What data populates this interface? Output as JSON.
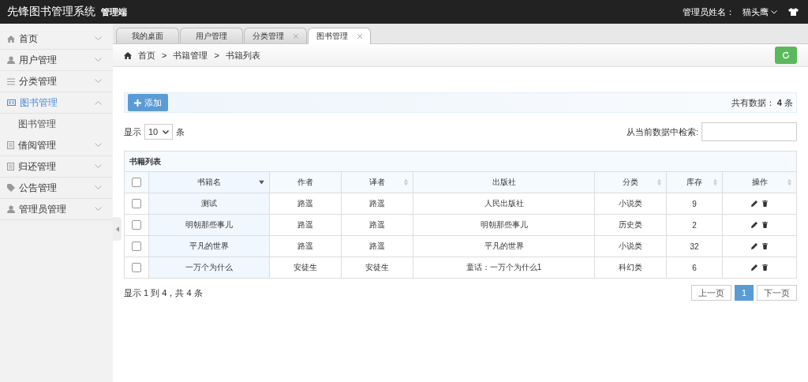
{
  "header": {
    "title": "先锋图书管理系统",
    "badge": "管理端",
    "user_label": "管理员姓名：",
    "user_name": "猫头鹰"
  },
  "sidebar": {
    "items": [
      {
        "label": "首页",
        "selected": false,
        "expanded": false
      },
      {
        "label": "用户管理",
        "selected": false,
        "expanded": false
      },
      {
        "label": "分类管理",
        "selected": false,
        "expanded": false
      },
      {
        "label": "图书管理",
        "selected": true,
        "expanded": true,
        "children": [
          {
            "label": "图书管理",
            "selected": false
          }
        ]
      },
      {
        "label": "借阅管理",
        "selected": false,
        "expanded": false
      },
      {
        "label": "归还管理",
        "selected": false,
        "expanded": false
      },
      {
        "label": "公告管理",
        "selected": false,
        "expanded": false
      },
      {
        "label": "管理员管理",
        "selected": false,
        "expanded": false
      }
    ]
  },
  "tabs": [
    {
      "label": "我的桌面",
      "selected": false,
      "closable": false
    },
    {
      "label": "用户管理",
      "selected": false,
      "closable": false
    },
    {
      "label": "分类管理",
      "selected": false,
      "closable": true
    },
    {
      "label": "图书管理",
      "selected": true,
      "closable": true
    }
  ],
  "breadcrumb": {
    "separator": ">",
    "items": [
      "首页",
      "书籍管理",
      "书籍列表"
    ]
  },
  "toolbar": {
    "add_button": "添加",
    "total_prefix": "共有数据：",
    "total_count": "4",
    "total_suffix": "条"
  },
  "length_menu": {
    "prefix": "显示",
    "value": "10",
    "suffix": "条"
  },
  "search": {
    "label": "从当前数据中检索:"
  },
  "table": {
    "caption": "书籍列表",
    "select_all": {
      "checked": false
    },
    "columns": [
      {
        "kind": "text",
        "label": "书籍名",
        "sorted": true,
        "sortable": true
      },
      {
        "kind": "text",
        "label": "作者",
        "sorted": false,
        "sortable": false
      },
      {
        "kind": "text",
        "label": "译者",
        "sorted": false,
        "sortable": true
      },
      {
        "kind": "text",
        "label": "出版社",
        "sorted": false,
        "sortable": false
      },
      {
        "kind": "text",
        "label": "分类",
        "sorted": false,
        "sortable": true
      },
      {
        "kind": "text",
        "label": "库存",
        "sorted": false,
        "sortable": true
      },
      {
        "kind": "actions",
        "label": "操作",
        "sorted": false,
        "sortable": true
      }
    ],
    "rows": [
      {
        "checked": false,
        "cells": [
          "测试",
          "路遥",
          "路遥",
          "人民出版社",
          "小说类",
          "9"
        ]
      },
      {
        "checked": false,
        "cells": [
          "明朝那些事儿",
          "路遥",
          "路遥",
          "明朝那些事儿",
          "历史类",
          "2"
        ]
      },
      {
        "checked": false,
        "cells": [
          "平凡的世界",
          "路遥",
          "路遥",
          "平凡的世界",
          "小说类",
          "32"
        ]
      },
      {
        "checked": false,
        "cells": [
          "一万个为什么",
          "安徒生",
          "安徒生",
          "童话：一万个为什么1",
          "科幻类",
          "6"
        ]
      }
    ]
  },
  "info": "显示 1 到 4，共 4 条",
  "pagination": {
    "prev": "上一页",
    "pages": [
      {
        "label": "1",
        "selected": true
      }
    ],
    "next": "下一页"
  }
}
